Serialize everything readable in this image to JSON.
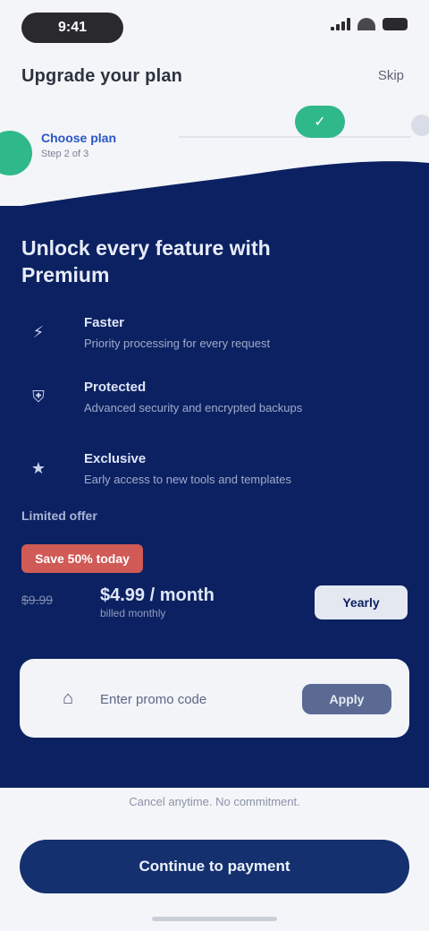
{
  "status_bar": {
    "time": "9:41",
    "icons": [
      "signal-icon",
      "wifi-icon",
      "battery-icon"
    ]
  },
  "app_bar": {
    "title": "Upgrade your plan",
    "action_label": "Skip"
  },
  "stepper": {
    "active_label": "Choose plan",
    "active_sub": "Step 2 of 3",
    "next_icon": "check-icon"
  },
  "panel": {
    "title": "Unlock every feature with Premium",
    "features": [
      {
        "icon": "bolt-icon",
        "title": "Faster",
        "desc": "Priority processing for every request"
      },
      {
        "icon": "shield-icon",
        "title": "Protected",
        "desc": "Advanced security and encrypted backups"
      },
      {
        "icon": "star-icon",
        "title": "Exclusive",
        "desc": "Early access to new tools and templates"
      }
    ],
    "offer_label": "Limited offer",
    "offer_badge": "Save 50% today",
    "price_old": "$9.99",
    "price_new": "$4.99 / month",
    "price_unit": "billed monthly",
    "toggle_label": "Yearly"
  },
  "promo": {
    "icon": "tag-icon",
    "placeholder": "Enter promo code",
    "apply_label": "Apply"
  },
  "footer": {
    "note": "Cancel anytime. No commitment.",
    "cta_label": "Continue to payment"
  },
  "colors": {
    "panel": "#0c2161",
    "accent_green": "#2fb98a",
    "badge_red": "#d05a56",
    "cta": "#14306f"
  }
}
